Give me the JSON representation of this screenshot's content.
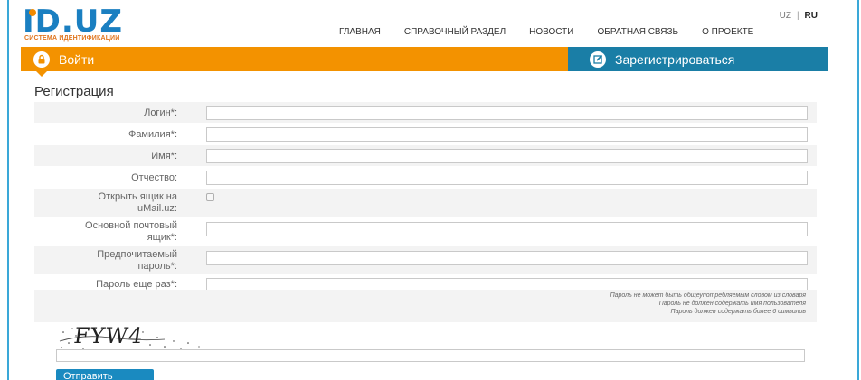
{
  "logo": {
    "text": "ID.UZ",
    "subtitle": "СИСТЕМА ИДЕНТИФИКАЦИИ"
  },
  "lang": {
    "uz": "UZ",
    "separator": "|",
    "ru": "RU"
  },
  "nav": [
    "ГЛАВНАЯ",
    "СПРАВОЧНЫЙ РАЗДЕЛ",
    "НОВОСТИ",
    "ОБРАТНАЯ СВЯЗЬ",
    "О ПРОЕКТЕ"
  ],
  "tabs": {
    "login": "Войти",
    "register": "Зарегистрироваться"
  },
  "page_title": "Регистрация",
  "form": {
    "login_label": "Логин*:",
    "surname_label": "Фамилия*:",
    "name_label": "Имя*:",
    "patronymic_label": "Отчество:",
    "open_mailbox_label": "Открыть ящик на uMail.uz:",
    "main_email_label": "Основной почтовый ящик*:",
    "password_label": "Предпочитаемый пароль*:",
    "password_repeat_label": "Пароль еще раз*:"
  },
  "hints": [
    "Пароль не может быть общеупотребляемым словом из словаря",
    "Пароль не должен содержать имя пользователя",
    "Пароль должен содержать более 6 символов"
  ],
  "captcha": {
    "text": "FYW4"
  },
  "submit_label": "Отправить",
  "colors": {
    "orange": "#f39200",
    "blue": "#1a7ea6",
    "logo_blue": "#1a7fc1"
  }
}
